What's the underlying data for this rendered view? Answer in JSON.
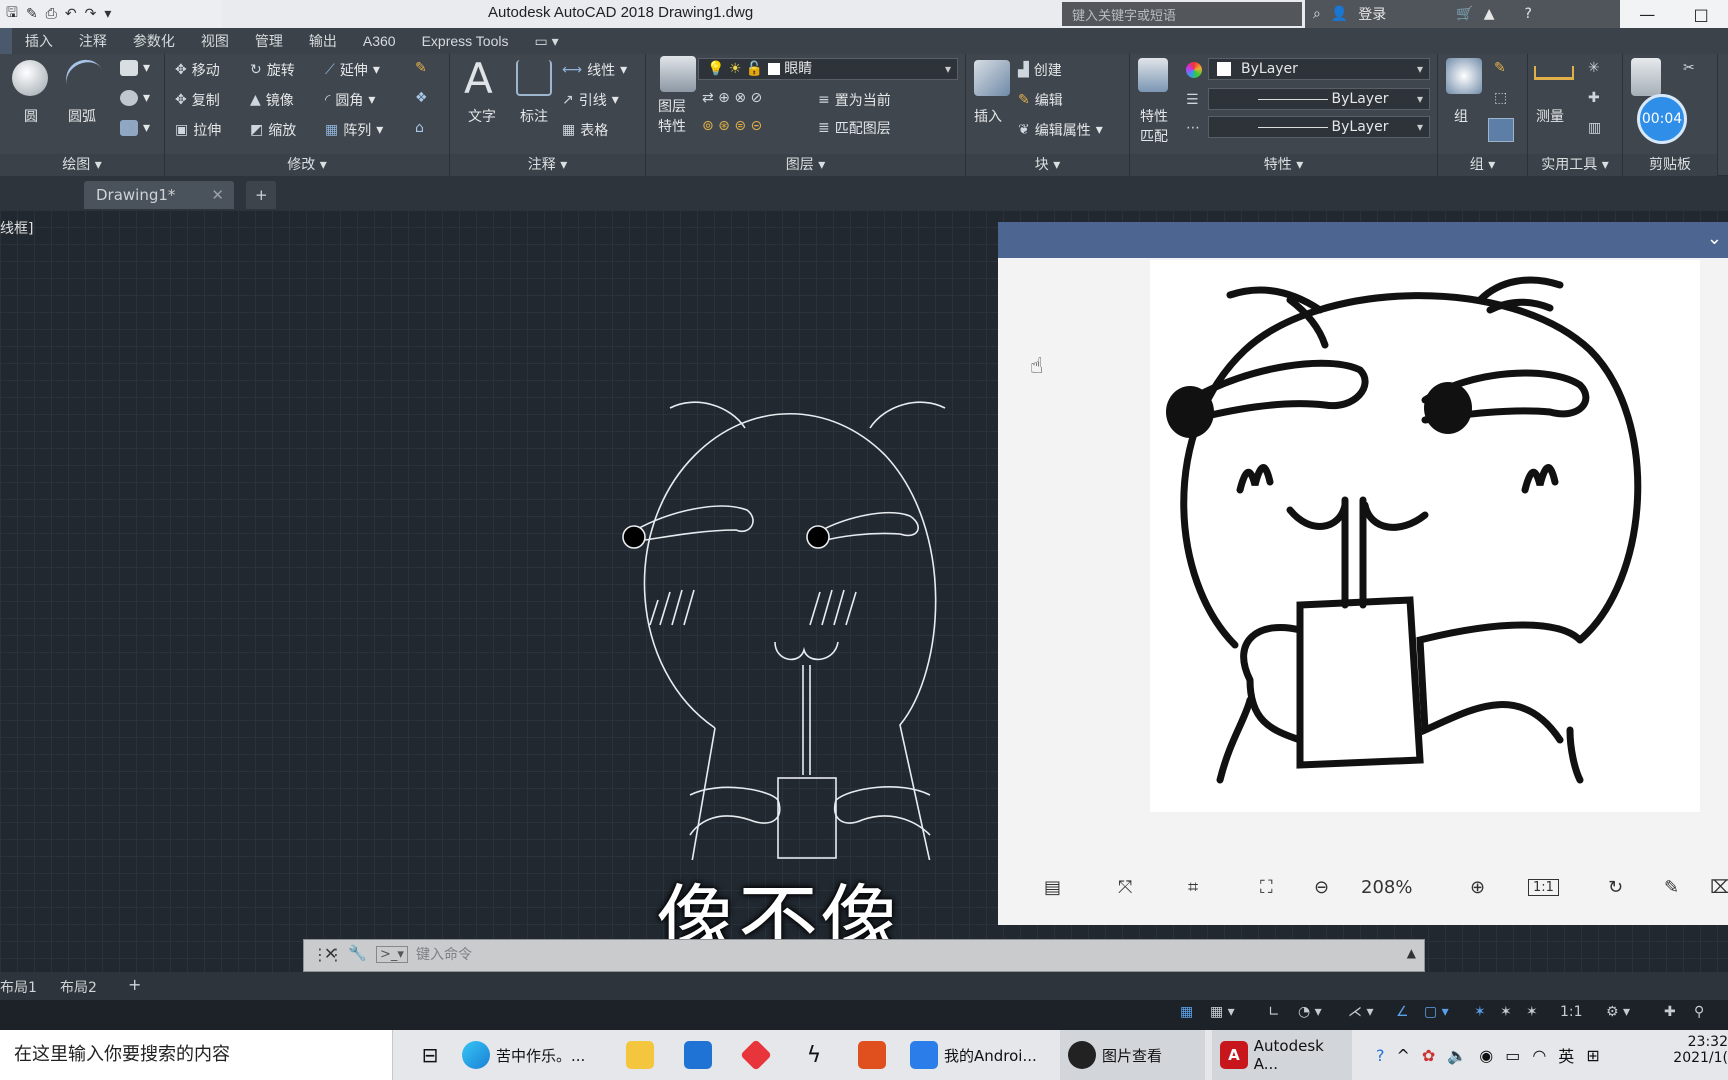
{
  "window": {
    "title": "Autodesk AutoCAD 2018    Drawing1.dwg",
    "search_placeholder": "键入关键字或短语",
    "login_label": "登录",
    "controls": [
      "—",
      "□"
    ]
  },
  "menu": {
    "tabs": [
      "插入",
      "注释",
      "参数化",
      "视图",
      "管理",
      "输出",
      "A360",
      "Express Tools"
    ]
  },
  "ribbon": {
    "draw": {
      "label": "绘图 ▾",
      "circle": "圆",
      "arc": "圆弧"
    },
    "modify": {
      "label": "修改 ▾",
      "move": "移动",
      "rotate": "旋转",
      "extend": "延伸",
      "copy": "复制",
      "mirror": "镜像",
      "fillet": "圆角",
      "stretch": "拉伸",
      "scale": "缩放",
      "array": "阵列"
    },
    "annotation": {
      "label": "注释 ▾",
      "text": "文字",
      "dimension": "标注",
      "linetype": "线性",
      "leader": "引线",
      "table": "表格"
    },
    "layers": {
      "label": "图层 ▾",
      "properties": "图层\n特性",
      "properties_l1": "图层",
      "properties_l2": "特性",
      "current_layer": "眼睛",
      "set_current": "置为当前",
      "match_layer": "匹配图层"
    },
    "block": {
      "label": "块 ▾",
      "insert": "插入",
      "create": "创建",
      "edit": "编辑",
      "edit_attr": "编辑属性"
    },
    "properties": {
      "label": "特性 ▾",
      "match_l1": "特性",
      "match_l2": "匹配",
      "color": "ByLayer",
      "linetype": "ByLayer",
      "lineweight": "ByLayer"
    },
    "group": {
      "label": "组 ▾",
      "group": "组"
    },
    "utilities": {
      "label": "实用工具 ▾",
      "measure": "测量"
    },
    "clipboard": {
      "label": "剪贴板",
      "timer": "00:04"
    }
  },
  "filetabs": {
    "active": "Drawing1*",
    "add": "+"
  },
  "viewport_label": "线框]",
  "subtitle": "像不像",
  "viewer": {
    "zoom": "208%",
    "actual_size": "1:1"
  },
  "command": {
    "placeholder": "键入命令"
  },
  "layout_tabs": [
    "布局1",
    "布局2",
    "+"
  ],
  "status": {
    "scale": "1:1"
  },
  "taskbar": {
    "search": "在这里输入你要搜索的内容",
    "items": [
      {
        "label": "苦中作乐。...",
        "color": "#1b7fd6"
      },
      {
        "label": "我的Androi...",
        "color": "#2b7de9"
      },
      {
        "label": "图片查看",
        "color": "#333333"
      },
      {
        "label": "Autodesk A...",
        "color": "#c8161d"
      }
    ],
    "ime": "英",
    "time": "23:32",
    "date": "2021/1("
  },
  "colors": {
    "ribbon_bg": "#3f464e",
    "canvas_bg": "#212830",
    "viewer_header": "#4d6691",
    "timer_badge": "#2e8ee8"
  }
}
